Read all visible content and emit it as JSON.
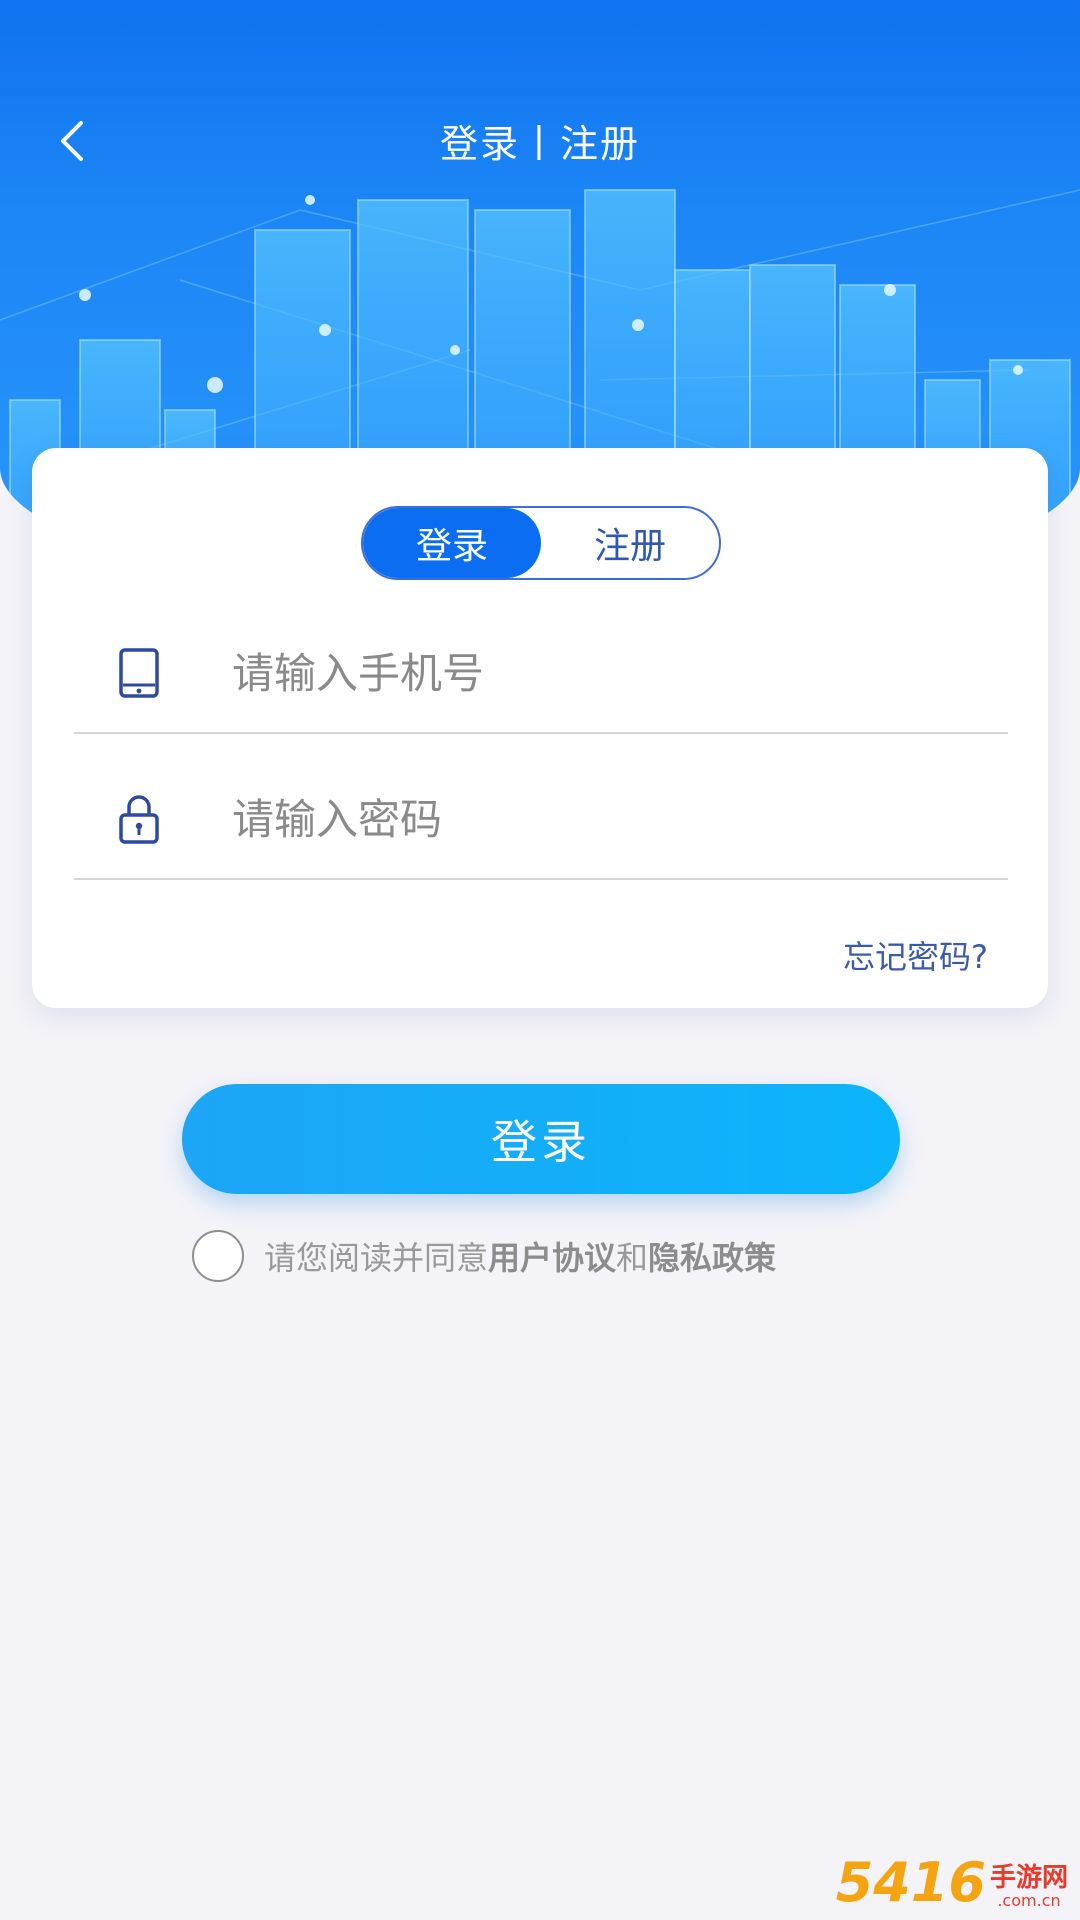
{
  "header": {
    "title": "登录丨注册",
    "back_icon": "chevron-left-icon"
  },
  "tabs": {
    "login_label": "登录",
    "register_label": "注册",
    "active": "login"
  },
  "form": {
    "phone": {
      "placeholder": "请输入手机号",
      "value": "",
      "icon": "phone-icon"
    },
    "password": {
      "placeholder": "请输入密码",
      "value": "",
      "icon": "lock-icon"
    },
    "forgot_label": "忘记密码?"
  },
  "actions": {
    "login_button_label": "登录"
  },
  "agreement": {
    "prefix": "请您阅读并同意",
    "user_agreement": "用户协议",
    "connector": "和",
    "privacy_policy": "隐私政策",
    "checked": false
  },
  "watermark": {
    "number": "5416",
    "text": "手游网",
    "url": ".com.cn"
  },
  "colors": {
    "banner": "#1480f4",
    "accent": "#0b6ef2",
    "login_button": "#12aef8",
    "link_text": "#3a5ba8"
  }
}
